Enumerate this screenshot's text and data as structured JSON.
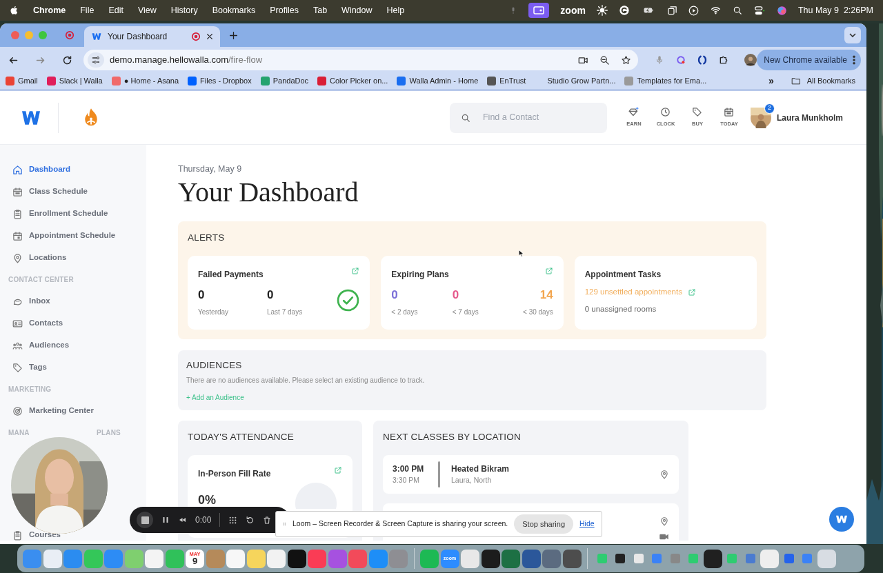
{
  "menu_bar": {
    "app": "Chrome",
    "menus": [
      "File",
      "Edit",
      "View",
      "History",
      "Bookmarks",
      "Profiles",
      "Tab",
      "Window",
      "Help"
    ],
    "zoom_label": "zoom",
    "clock": "Thu May 9  2:26PM"
  },
  "browser": {
    "tabs": [
      {
        "title": "Your Dashboard",
        "selected": true
      }
    ],
    "url_host": "demo.manage.hellowalla.com",
    "url_path": "/fire-flow",
    "update_button": "New Chrome available",
    "bookmarks": [
      {
        "label": "Gmail",
        "color": "#ea4335"
      },
      {
        "label": "Slack | Walla",
        "color": "#e01e5a"
      },
      {
        "label": "● Home - Asana",
        "color": "#f06a6a"
      },
      {
        "label": "Files - Dropbox",
        "color": "#0061fe"
      },
      {
        "label": "PandaDoc",
        "color": "#25a36f"
      },
      {
        "label": "Color Picker on...",
        "color": "#d91e36"
      },
      {
        "label": "Walla Admin - Home",
        "color": "#1a6ef0"
      },
      {
        "label": "EnTrust",
        "color": "#555555"
      },
      {
        "label": "Studio Grow Partn..."
      },
      {
        "label": "Templates for Ema...",
        "color": "#9a9a9a"
      }
    ],
    "overflow": "»",
    "all_bookmarks": "All Bookmarks"
  },
  "app": {
    "search": {
      "placeholder": "Find a Contact"
    },
    "shortcuts": [
      "EARN",
      "CLOCK",
      "BUY",
      "TODAY"
    ],
    "user": {
      "name": "Laura Munkholm",
      "badge": "2"
    }
  },
  "sidebar": [
    {
      "kind": "link",
      "label": "Dashboard",
      "selected": true
    },
    {
      "kind": "link",
      "label": "Class Schedule",
      "selected": false
    },
    {
      "kind": "link",
      "label": "Enrollment Schedule",
      "selected": false
    },
    {
      "kind": "link",
      "label": "Appointment Schedule",
      "selected": false
    },
    {
      "kind": "link",
      "label": "Locations",
      "selected": false
    },
    {
      "kind": "heading",
      "label": "CONTACT CENTER"
    },
    {
      "kind": "link",
      "label": "Inbox",
      "selected": false
    },
    {
      "kind": "link",
      "label": "Contacts",
      "selected": false
    },
    {
      "kind": "link",
      "label": "Audiences",
      "selected": false
    },
    {
      "kind": "link",
      "label": "Tags",
      "selected": false
    },
    {
      "kind": "heading",
      "label": "MARKETING"
    },
    {
      "kind": "link",
      "label": "Marketing Center",
      "selected": false
    },
    {
      "kind": "split_heading",
      "label": "MANA",
      "label_end": "PLANS"
    },
    {
      "kind": "link",
      "label": "Courses",
      "selected": false
    }
  ],
  "main": {
    "date": "Thursday, May 9",
    "title": "Your Dashboard",
    "alerts": {
      "heading": "ALERTS",
      "cards": [
        {
          "kind": "stats",
          "title": "Failed Payments",
          "ok": true,
          "stats": [
            {
              "value": "0",
              "label": "Yesterday",
              "color": "#222222"
            },
            {
              "value": "0",
              "label": "Last 7 days",
              "color": "#222222"
            }
          ]
        },
        {
          "kind": "stats",
          "title": "Expiring Plans",
          "ok": false,
          "stats": [
            {
              "value": "0",
              "label": "< 2 days",
              "color": "#7b6fd8"
            },
            {
              "value": "0",
              "label": "< 7 days",
              "color": "#e5578a"
            },
            {
              "value": "14",
              "label": "< 30 days",
              "color": "#f2a54e"
            }
          ]
        },
        {
          "kind": "tasks",
          "title": "Appointment Tasks",
          "link": "129 unsettled appointments",
          "note": "0 unassigned rooms"
        }
      ]
    },
    "audiences": {
      "heading": "AUDIENCES",
      "message": "There are no audiences available. Please select an existing audience to track.",
      "add": "+ Add an Audience"
    },
    "attendance": {
      "heading": "TODAY'S ATTENDANCE",
      "card_title": "In-Person Fill Rate",
      "value": "0%"
    },
    "next_classes": {
      "heading": "NEXT CLASSES BY LOCATION",
      "classes": [
        {
          "time": "3:00 PM",
          "end": "3:30 PM",
          "name": "Heated Bikram",
          "detail": "Laura, North",
          "virtual": false
        },
        {
          "virtual": true
        }
      ]
    }
  },
  "recorder": {
    "timer": "0:00",
    "banner": "Loom – Screen Recorder & Screen Capture is sharing your screen.",
    "stop": "Stop sharing",
    "hide": "Hide"
  },
  "dock": [
    {
      "kind": "app",
      "color": "#3a8ef0"
    },
    {
      "kind": "app",
      "color": "#e9eef5"
    },
    {
      "kind": "app",
      "color": "#2b8cf0"
    },
    {
      "kind": "app",
      "color": "#34c759"
    },
    {
      "kind": "app",
      "color": "#2d8cf5"
    },
    {
      "kind": "app",
      "color": "#7fcf6f"
    },
    {
      "kind": "app",
      "color": "#f4f4f4"
    },
    {
      "kind": "app",
      "color": "#30c15a"
    },
    {
      "kind": "calendar",
      "color": "#ffffff",
      "top": "MAY",
      "label": "9"
    },
    {
      "kind": "app",
      "color": "#b58a5a"
    },
    {
      "kind": "app",
      "color": "#f7f7f7"
    },
    {
      "kind": "app",
      "color": "#f6d55c"
    },
    {
      "kind": "app",
      "color": "#f2f2f2"
    },
    {
      "kind": "app",
      "color": "#111111"
    },
    {
      "kind": "app",
      "color": "#fa3c55"
    },
    {
      "kind": "app",
      "color": "#a651e0"
    },
    {
      "kind": "app",
      "color": "#f24a5a"
    },
    {
      "kind": "app",
      "color": "#1e8ef7"
    },
    {
      "kind": "app",
      "color": "#8e8e93"
    },
    {
      "kind": "divider"
    },
    {
      "kind": "app",
      "color": "#1db954"
    },
    {
      "kind": "label",
      "color": "#2d8cff",
      "label": "zoom"
    },
    {
      "kind": "app",
      "color": "#e8e8e8"
    },
    {
      "kind": "app",
      "color": "#1c1c1c"
    },
    {
      "kind": "app",
      "color": "#1d7044"
    },
    {
      "kind": "app",
      "color": "#2b579a"
    },
    {
      "kind": "app",
      "color": "#5b6b80"
    },
    {
      "kind": "app",
      "color": "#4d4d4d"
    },
    {
      "kind": "divider"
    },
    {
      "kind": "mini",
      "color": "#2ecc71"
    },
    {
      "kind": "mini",
      "color": "#222222"
    },
    {
      "kind": "mini",
      "color": "#e8e8e8"
    },
    {
      "kind": "mini",
      "color": "#3b82f6"
    },
    {
      "kind": "mini",
      "color": "#888888"
    },
    {
      "kind": "mini",
      "color": "#2ecc71"
    },
    {
      "kind": "app",
      "color": "#202020"
    },
    {
      "kind": "mini",
      "color": "#2ecc71"
    },
    {
      "kind": "mini",
      "color": "#4a7bd0"
    },
    {
      "kind": "app",
      "color": "#eeeeee"
    },
    {
      "kind": "mini",
      "color": "#2563eb"
    },
    {
      "kind": "mini",
      "color": "#3b82f6"
    },
    {
      "kind": "app",
      "color": "#d8dde3"
    }
  ]
}
